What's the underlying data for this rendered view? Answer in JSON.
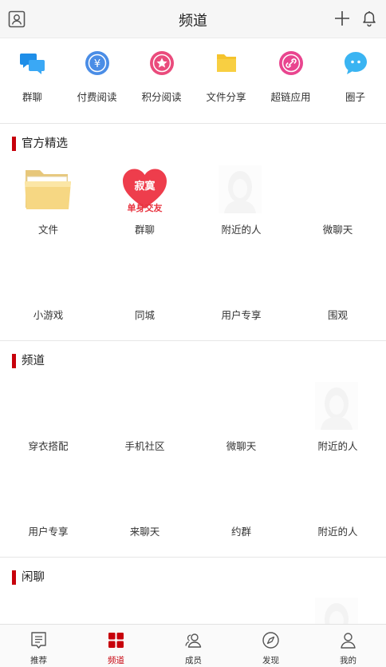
{
  "header": {
    "title": "频道"
  },
  "quick_actions": [
    {
      "label": "群聊",
      "icon": "chat-bubbles-icon",
      "color": "#1e8ee8"
    },
    {
      "label": "付费阅读",
      "icon": "yen-coin-icon",
      "color": "#4a8de6"
    },
    {
      "label": "积分阅读",
      "icon": "star-badge-icon",
      "color": "#ea4b7c"
    },
    {
      "label": "文件分享",
      "icon": "folder-icon",
      "color": "#f5c32c"
    },
    {
      "label": "超链应用",
      "icon": "link-icon",
      "color": "#e9458f"
    },
    {
      "label": "圈子",
      "icon": "chat-dots-icon",
      "color": "#3ab4f2"
    }
  ],
  "sections": [
    {
      "title": "官方精选",
      "items": [
        "文件",
        "群聊",
        "附近的人",
        "微聊天",
        "小游戏",
        "同城",
        "用户专享",
        "围观"
      ]
    },
    {
      "title": "频道",
      "items": [
        "穿衣搭配",
        "手机社区",
        "微聊天",
        "附近的人",
        "用户专享",
        "来聊天",
        "约群",
        "附近的人"
      ]
    },
    {
      "title": "闲聊",
      "items": []
    }
  ],
  "promo_image": {
    "line1": "寂寞",
    "line2": "单身交友"
  },
  "tabs": [
    {
      "label": "推荐",
      "icon": "article-icon",
      "active": false
    },
    {
      "label": "频道",
      "icon": "grid-icon",
      "active": true
    },
    {
      "label": "成员",
      "icon": "members-icon",
      "active": false
    },
    {
      "label": "发现",
      "icon": "compass-icon",
      "active": false
    },
    {
      "label": "我的",
      "icon": "user-icon",
      "active": false
    }
  ],
  "colors": {
    "accent": "#c7000b",
    "topbar_bg": "#f6f6f6",
    "tabbar_bg": "#fafafa"
  }
}
